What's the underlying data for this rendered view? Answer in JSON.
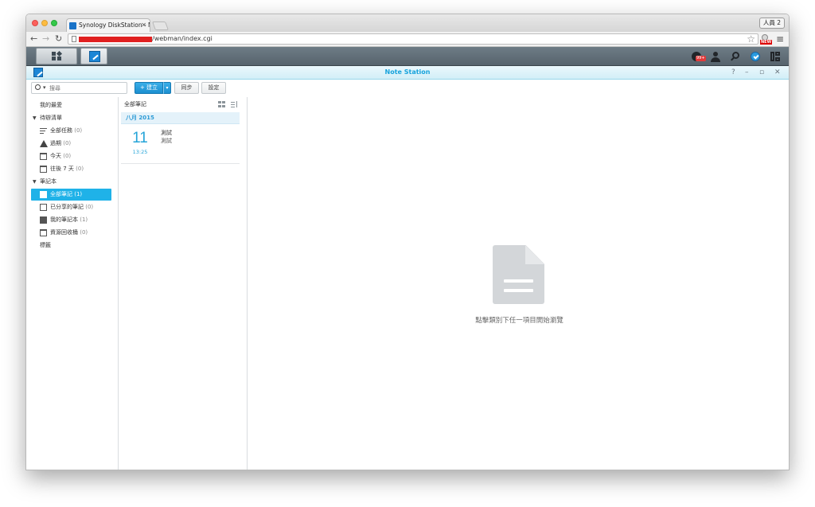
{
  "browser": {
    "tab_title": "Synology DiskStation - No",
    "tab_close": "✕",
    "profile_label": "人員 2",
    "url": "/webman/index.cgi",
    "ext_badge": "NEW"
  },
  "taskbar": {
    "notification_count": "99+"
  },
  "app": {
    "title": "Note Station",
    "window_controls": {
      "help": "?",
      "minimize": "–",
      "restore": "▫",
      "close": "✕"
    }
  },
  "toolbar": {
    "search_placeholder": "搜尋",
    "create_label": "+ 建立",
    "sync_label": "同步",
    "settings_label": "設定"
  },
  "sidebar": {
    "favorites": "我的最愛",
    "todo_section": "待辦清單",
    "todo_items": [
      {
        "label": "全部任務",
        "count": "(0)"
      },
      {
        "label": "過期",
        "count": "(0)"
      },
      {
        "label": "今天",
        "count": "(0)"
      },
      {
        "label": "往後 7 天",
        "count": "(0)"
      }
    ],
    "notebook_section": "筆記本",
    "notebook_items": [
      {
        "label": "全部筆記",
        "count": "(1)"
      },
      {
        "label": "已分享的筆記",
        "count": "(0)"
      },
      {
        "label": "我的筆記本",
        "count": "(1)"
      },
      {
        "label": "資源回收桶",
        "count": "(0)"
      }
    ],
    "tags": "標籤"
  },
  "notelist": {
    "header": "全部筆記",
    "month": "八月 2015",
    "notes": [
      {
        "day": "11",
        "time": "13:25",
        "title": "測試",
        "snippet": "測試"
      }
    ]
  },
  "content": {
    "empty_text": "點擊類別下任一項目開始瀏覽"
  }
}
